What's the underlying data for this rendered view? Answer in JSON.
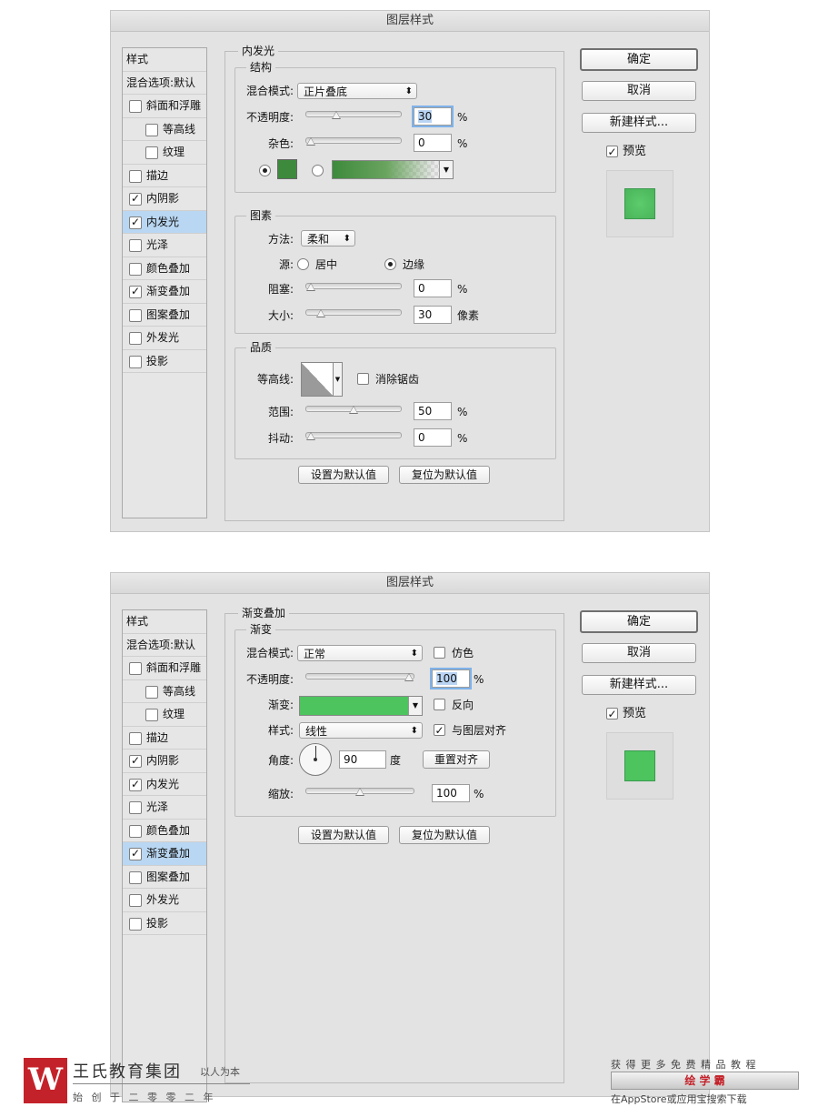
{
  "colors": {
    "accent_green": "#4dbd61",
    "swatch_dark": "#3d8a3c",
    "grad_green": "#3d8a3c",
    "preview_green": "#4dc45e",
    "selection": "#b9d7f2",
    "brand_red": "#c4222a"
  },
  "dialogs": [
    {
      "title": "图层样式",
      "sidebar": [
        {
          "label": "样式",
          "checked": false,
          "type": "header"
        },
        {
          "label": "混合选项:默认",
          "checked": false,
          "type": "header"
        },
        {
          "label": "斜面和浮雕",
          "checked": false,
          "type": "item"
        },
        {
          "label": "等高线",
          "checked": false,
          "type": "sub"
        },
        {
          "label": "纹理",
          "checked": false,
          "type": "sub"
        },
        {
          "label": "描边",
          "checked": false,
          "type": "item"
        },
        {
          "label": "内阴影",
          "checked": true,
          "type": "item"
        },
        {
          "label": "内发光",
          "checked": true,
          "type": "item",
          "active": true
        },
        {
          "label": "光泽",
          "checked": false,
          "type": "item"
        },
        {
          "label": "颜色叠加",
          "checked": false,
          "type": "item"
        },
        {
          "label": "渐变叠加",
          "checked": true,
          "type": "item"
        },
        {
          "label": "图案叠加",
          "checked": false,
          "type": "item"
        },
        {
          "label": "外发光",
          "checked": false,
          "type": "item"
        },
        {
          "label": "投影",
          "checked": false,
          "type": "item"
        }
      ],
      "panel_title": "内发光",
      "structure": {
        "title": "结构",
        "blend_mode_label": "混合模式:",
        "blend_mode": "正片叠底",
        "opacity_label": "不透明度:",
        "opacity": "30",
        "opacity_unit": "%",
        "opacity_slider": 0.3,
        "noise_label": "杂色:",
        "noise": "0",
        "noise_unit": "%",
        "noise_slider": 0.0
      },
      "elements": {
        "title": "图素",
        "technique_label": "方法:",
        "technique": "柔和",
        "source_label": "源:",
        "source_center": "居中",
        "source_edge": "边缘",
        "source_selected": "边缘",
        "choke_label": "阻塞:",
        "choke": "0",
        "choke_unit": "%",
        "choke_slider": 0.0,
        "size_label": "大小:",
        "size": "30",
        "size_unit": "像素",
        "size_slider": 0.12
      },
      "quality": {
        "title": "品质",
        "contour_label": "等高线:",
        "antialias_label": "消除锯齿",
        "antialias": false,
        "range_label": "范围:",
        "range": "50",
        "range_unit": "%",
        "range_slider": 0.5,
        "jitter_label": "抖动:",
        "jitter": "0",
        "jitter_unit": "%",
        "jitter_slider": 0.0
      },
      "make_default": "设置为默认值",
      "reset_default": "复位为默认值",
      "buttons": {
        "ok": "确定",
        "cancel": "取消",
        "new_style": "新建样式...",
        "preview": "预览",
        "preview_checked": true
      }
    },
    {
      "title": "图层样式",
      "sidebar": [
        {
          "label": "样式",
          "checked": false,
          "type": "header"
        },
        {
          "label": "混合选项:默认",
          "checked": false,
          "type": "header"
        },
        {
          "label": "斜面和浮雕",
          "checked": false,
          "type": "item"
        },
        {
          "label": "等高线",
          "checked": false,
          "type": "sub"
        },
        {
          "label": "纹理",
          "checked": false,
          "type": "sub"
        },
        {
          "label": "描边",
          "checked": false,
          "type": "item"
        },
        {
          "label": "内阴影",
          "checked": true,
          "type": "item"
        },
        {
          "label": "内发光",
          "checked": true,
          "type": "item"
        },
        {
          "label": "光泽",
          "checked": false,
          "type": "item"
        },
        {
          "label": "颜色叠加",
          "checked": false,
          "type": "item"
        },
        {
          "label": "渐变叠加",
          "checked": true,
          "type": "item",
          "active": true
        },
        {
          "label": "图案叠加",
          "checked": false,
          "type": "item"
        },
        {
          "label": "外发光",
          "checked": false,
          "type": "item"
        },
        {
          "label": "投影",
          "checked": false,
          "type": "item"
        }
      ],
      "panel_title": "渐变叠加",
      "gradient": {
        "title": "渐变",
        "blend_mode_label": "混合模式:",
        "blend_mode": "正常",
        "dither_label": "仿色",
        "dither": false,
        "opacity_label": "不透明度:",
        "opacity": "100",
        "opacity_unit": "%",
        "opacity_slider": 1.0,
        "gradient_label": "渐变:",
        "reverse_label": "反向",
        "reverse": false,
        "style_label": "样式:",
        "style": "线性",
        "align_label": "与图层对齐",
        "align": true,
        "angle_label": "角度:",
        "angle": "90",
        "angle_unit": "度",
        "reset_align": "重置对齐",
        "scale_label": "缩放:",
        "scale": "100",
        "scale_unit": "%",
        "scale_slider": 0.5
      },
      "make_default": "设置为默认值",
      "reset_default": "复位为默认值",
      "buttons": {
        "ok": "确定",
        "cancel": "取消",
        "new_style": "新建样式...",
        "preview": "预览",
        "preview_checked": true
      }
    }
  ],
  "footer": {
    "logo_char": "W",
    "brand_name": "王氏教育集团",
    "slogan": "以人为本",
    "founded": "始 创 于 二 零 零 二 年",
    "promo_line1": "获 得 更 多 免 费 精 品 教 程",
    "promo_app": "绘 学 霸",
    "promo_line3": "在AppStore或应用宝搜索下载"
  }
}
